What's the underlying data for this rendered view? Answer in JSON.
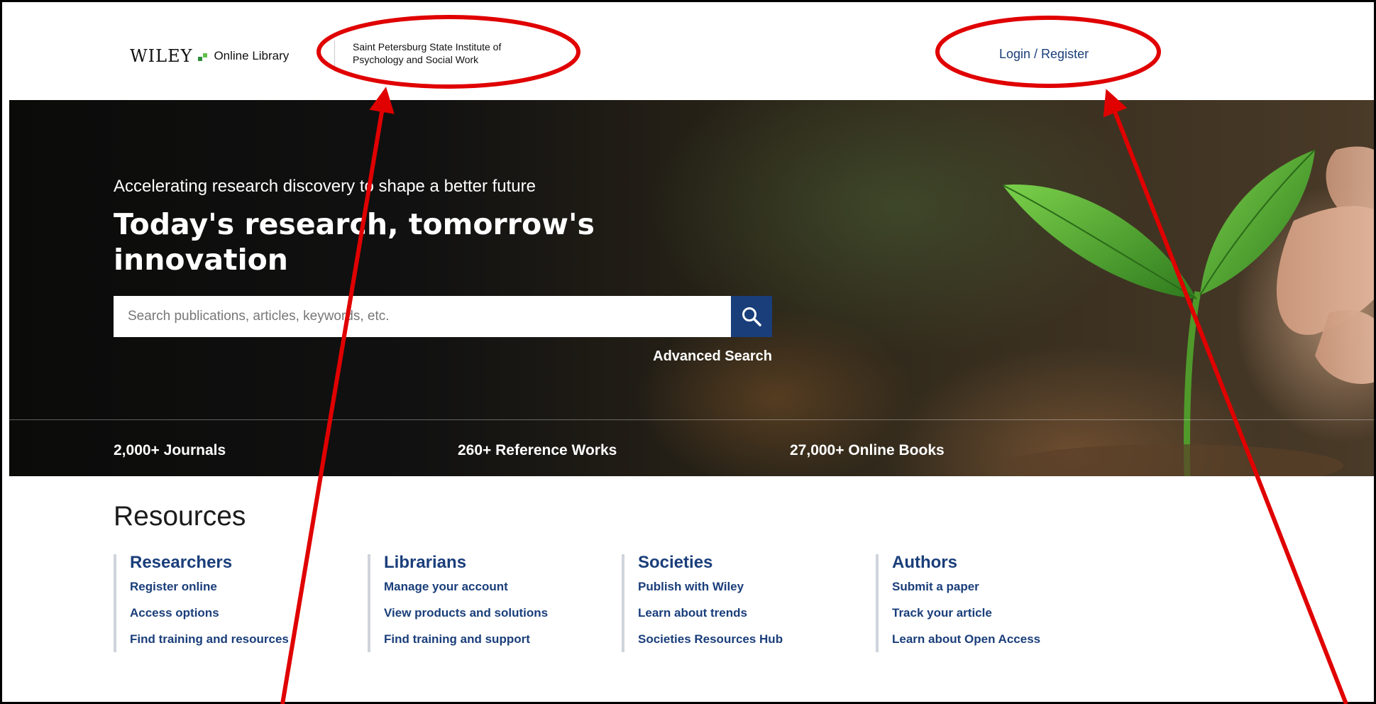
{
  "header": {
    "logo_wiley": "WILEY",
    "logo_online_library": "Online Library",
    "institution": "Saint Petersburg State Institute of Psychology and Social Work",
    "login_label": "Login / Register"
  },
  "hero": {
    "subtitle": "Accelerating research discovery to shape a better future",
    "title": "Today's research, tomorrow's innovation",
    "search": {
      "placeholder": "Search publications, articles, keywords, etc.",
      "value": "",
      "button_icon": "search-icon"
    },
    "advanced_search_label": "Advanced Search",
    "stats": [
      "2,000+ Journals",
      "260+ Reference Works",
      "27,000+ Online Books"
    ]
  },
  "resources": {
    "title": "Resources",
    "columns": [
      {
        "heading": "Researchers",
        "links": [
          "Register online",
          "Access options",
          "Find training and resources"
        ]
      },
      {
        "heading": "Librarians",
        "links": [
          "Manage your account",
          "View products and solutions",
          "Find training and support"
        ]
      },
      {
        "heading": "Societies",
        "links": [
          "Publish with Wiley",
          "Learn about trends",
          "Societies Resources Hub"
        ]
      },
      {
        "heading": "Authors",
        "links": [
          "Submit a paper",
          "Track your article",
          "Learn about Open Access"
        ]
      }
    ]
  },
  "colors": {
    "brand_blue": "#1a3e7a",
    "annotation_red": "#e00000",
    "wiley_green": "#2d8d3a"
  }
}
